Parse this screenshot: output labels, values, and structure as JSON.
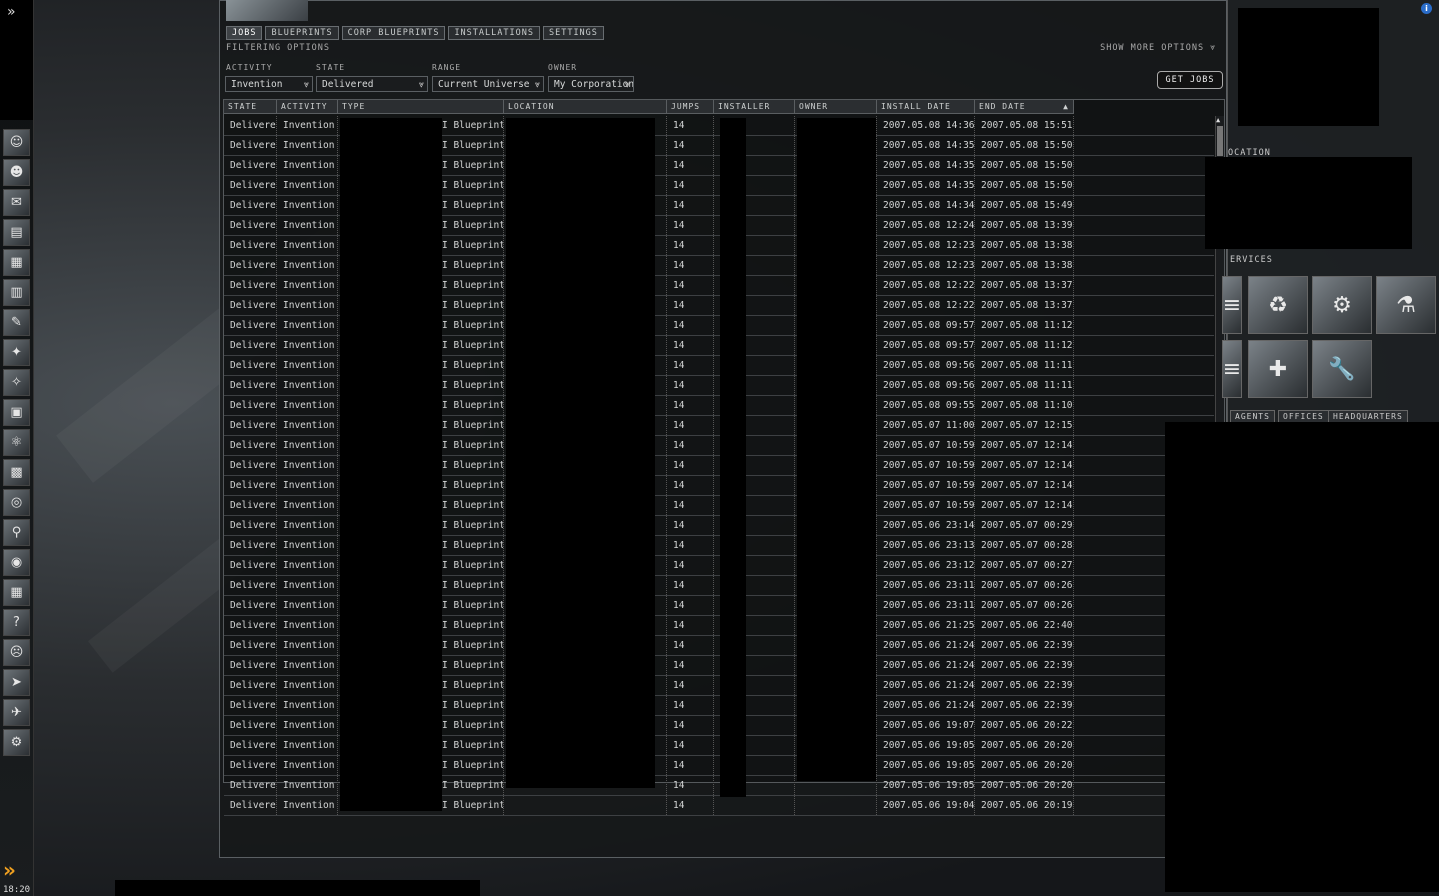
{
  "tabs": [
    "Jobs",
    "Blueprints",
    "Corp Blueprints",
    "Installations",
    "Settings"
  ],
  "filter_title": "FILTERING OPTIONS",
  "more_options": "SHOW MORE OPTIONS",
  "filters": {
    "activity_label": "ACTIVITY",
    "activity_value": "Invention",
    "state_label": "STATE",
    "state_value": "Delivered",
    "range_label": "RANGE",
    "range_value": "Current Universe",
    "owner_label": "OWNER",
    "owner_value": "My Corporation"
  },
  "get_jobs_label": "GET JOBS",
  "columns": [
    "STATE",
    "ACTIVITY",
    "TYPE",
    "LOCATION",
    "JUMPS",
    "INSTALLER",
    "OWNER",
    "INSTALL DATE",
    "END DATE"
  ],
  "rows": [
    [
      "Delivered",
      "Invention",
      "I Blueprint",
      "14",
      "2007.05.08 14:36",
      "2007.05.08 15:51"
    ],
    [
      "Delivered",
      "Invention",
      "I Blueprint",
      "14",
      "2007.05.08 14:35",
      "2007.05.08 15:50"
    ],
    [
      "Delivered",
      "Invention",
      "I Blueprint",
      "14",
      "2007.05.08 14:35",
      "2007.05.08 15:50"
    ],
    [
      "Delivered",
      "Invention",
      "I Blueprint",
      "14",
      "2007.05.08 14:35",
      "2007.05.08 15:50"
    ],
    [
      "Delivered",
      "Invention",
      "I Blueprint",
      "14",
      "2007.05.08 14:34",
      "2007.05.08 15:49"
    ],
    [
      "Delivered",
      "Invention",
      "I Blueprint",
      "14",
      "2007.05.08 12:24",
      "2007.05.08 13:39"
    ],
    [
      "Delivered",
      "Invention",
      "I Blueprint",
      "14",
      "2007.05.08 12:23",
      "2007.05.08 13:38"
    ],
    [
      "Delivered",
      "Invention",
      "I Blueprint",
      "14",
      "2007.05.08 12:23",
      "2007.05.08 13:38"
    ],
    [
      "Delivered",
      "Invention",
      "I Blueprint",
      "14",
      "2007.05.08 12:22",
      "2007.05.08 13:37"
    ],
    [
      "Delivered",
      "Invention",
      "I Blueprint",
      "14",
      "2007.05.08 12:22",
      "2007.05.08 13:37"
    ],
    [
      "Delivered",
      "Invention",
      "I Blueprint",
      "14",
      "2007.05.08 09:57",
      "2007.05.08 11:12"
    ],
    [
      "Delivered",
      "Invention",
      "I Blueprint",
      "14",
      "2007.05.08 09:57",
      "2007.05.08 11:12"
    ],
    [
      "Delivered",
      "Invention",
      "I Blueprint",
      "14",
      "2007.05.08 09:56",
      "2007.05.08 11:11"
    ],
    [
      "Delivered",
      "Invention",
      "I Blueprint",
      "14",
      "2007.05.08 09:56",
      "2007.05.08 11:11"
    ],
    [
      "Delivered",
      "Invention",
      "I Blueprint",
      "14",
      "2007.05.08 09:55",
      "2007.05.08 11:10"
    ],
    [
      "Delivered",
      "Invention",
      "I Blueprint",
      "14",
      "2007.05.07 11:00",
      "2007.05.07 12:15"
    ],
    [
      "Delivered",
      "Invention",
      "I Blueprint",
      "14",
      "2007.05.07 10:59",
      "2007.05.07 12:14"
    ],
    [
      "Delivered",
      "Invention",
      "I Blueprint",
      "14",
      "2007.05.07 10:59",
      "2007.05.07 12:14"
    ],
    [
      "Delivered",
      "Invention",
      "I Blueprint",
      "14",
      "2007.05.07 10:59",
      "2007.05.07 12:14"
    ],
    [
      "Delivered",
      "Invention",
      "I Blueprint",
      "14",
      "2007.05.07 10:59",
      "2007.05.07 12:14"
    ],
    [
      "Delivered",
      "Invention",
      "I Blueprint",
      "14",
      "2007.05.06 23:14",
      "2007.05.07 00:29"
    ],
    [
      "Delivered",
      "Invention",
      "I Blueprint",
      "14",
      "2007.05.06 23:13",
      "2007.05.07 00:28"
    ],
    [
      "Delivered",
      "Invention",
      "I Blueprint",
      "14",
      "2007.05.06 23:12",
      "2007.05.07 00:27"
    ],
    [
      "Delivered",
      "Invention",
      "I Blueprint",
      "14",
      "2007.05.06 23:11",
      "2007.05.07 00:26"
    ],
    [
      "Delivered",
      "Invention",
      "I Blueprint",
      "14",
      "2007.05.06 23:11",
      "2007.05.07 00:26"
    ],
    [
      "Delivered",
      "Invention",
      "I Blueprint",
      "14",
      "2007.05.06 21:25",
      "2007.05.06 22:40"
    ],
    [
      "Delivered",
      "Invention",
      "I Blueprint",
      "14",
      "2007.05.06 21:24",
      "2007.05.06 22:39"
    ],
    [
      "Delivered",
      "Invention",
      "I Blueprint",
      "14",
      "2007.05.06 21:24",
      "2007.05.06 22:39"
    ],
    [
      "Delivered",
      "Invention",
      "I Blueprint",
      "14",
      "2007.05.06 21:24",
      "2007.05.06 22:39"
    ],
    [
      "Delivered",
      "Invention",
      "I Blueprint",
      "14",
      "2007.05.06 21:24",
      "2007.05.06 22:39"
    ],
    [
      "Delivered",
      "Invention",
      "I Blueprint",
      "14",
      "2007.05.06 19:07",
      "2007.05.06 20:22"
    ],
    [
      "Delivered",
      "Invention",
      "I Blueprint",
      "14",
      "2007.05.06 19:05",
      "2007.05.06 20:20"
    ],
    [
      "Delivered",
      "Invention",
      "I Blueprint",
      "14",
      "2007.05.06 19:05",
      "2007.05.06 20:20"
    ],
    [
      "Delivered",
      "Invention",
      "I Blueprint",
      "14",
      "2007.05.06 19:05",
      "2007.05.06 20:20"
    ],
    [
      "Delivered",
      "Invention",
      "I Blueprint",
      "14",
      "2007.05.06 19:04",
      "2007.05.06 20:19"
    ]
  ],
  "station": {
    "location_label": "OCATION",
    "services_label": "ERVICES",
    "tabs": [
      "AGENTS",
      "OFFICES",
      "HEADQUARTERS"
    ]
  },
  "clock": "18:20",
  "icons": {
    "neocom": [
      "character-icon",
      "people-icon",
      "mail-icon",
      "notepad-icon",
      "assets-icon",
      "wallet-icon",
      "journal-icon",
      "map-icon",
      "starmap-icon",
      "cargo-icon",
      "science-icon",
      "calculator-icon",
      "help-icon",
      "skills-icon",
      "market-icon",
      "corporation-icon",
      "contracts-icon",
      "info-icon",
      "portrait-icon",
      "ship-icon",
      "fitting-icon"
    ],
    "services": [
      "reprocessing-icon",
      "factory-icon",
      "laboratory-icon",
      "medical-icon",
      "repair-icon"
    ]
  }
}
